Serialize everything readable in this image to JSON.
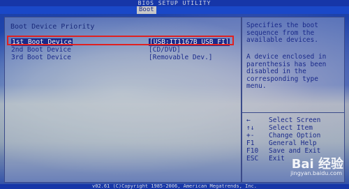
{
  "title": "BIOS SETUP UTILITY",
  "menu": {
    "active_tab": "Boot"
  },
  "main": {
    "heading": "Boot Device Priority",
    "devices": [
      {
        "label": "1st Boot Device",
        "value": "[USB:IT1167B USB FI]"
      },
      {
        "label": "2nd Boot Device",
        "value": "[CD/DVD]"
      },
      {
        "label": "3rd Boot Device",
        "value": "[Removable Dev.]"
      }
    ]
  },
  "help": {
    "lines_1": [
      "Specifies the boot",
      "sequence from the",
      "available devices."
    ],
    "lines_2": [
      "A device enclosed in",
      "parenthesis has been",
      "disabled in the",
      "corresponding type",
      "menu."
    ],
    "keys": [
      {
        "key": "←",
        "desc": "Select Screen"
      },
      {
        "key": "↑↓",
        "desc": "Select Item"
      },
      {
        "key": "+-",
        "desc": "Change Option"
      },
      {
        "key": "F1",
        "desc": "General Help"
      },
      {
        "key": "F10",
        "desc": "Save and Exit"
      },
      {
        "key": "ESC",
        "desc": "Exit"
      }
    ]
  },
  "footer": "v02.61 (C)Copyright 1985-2006, American Megatrends, Inc.",
  "watermark": {
    "main": "Bai 经验",
    "sub": "jingyan.baidu.com"
  },
  "colors": {
    "text": "#1a2a8a",
    "selection": "#1a2a8a",
    "highlight_border": "#e02020",
    "bar": "#1a48c8"
  }
}
